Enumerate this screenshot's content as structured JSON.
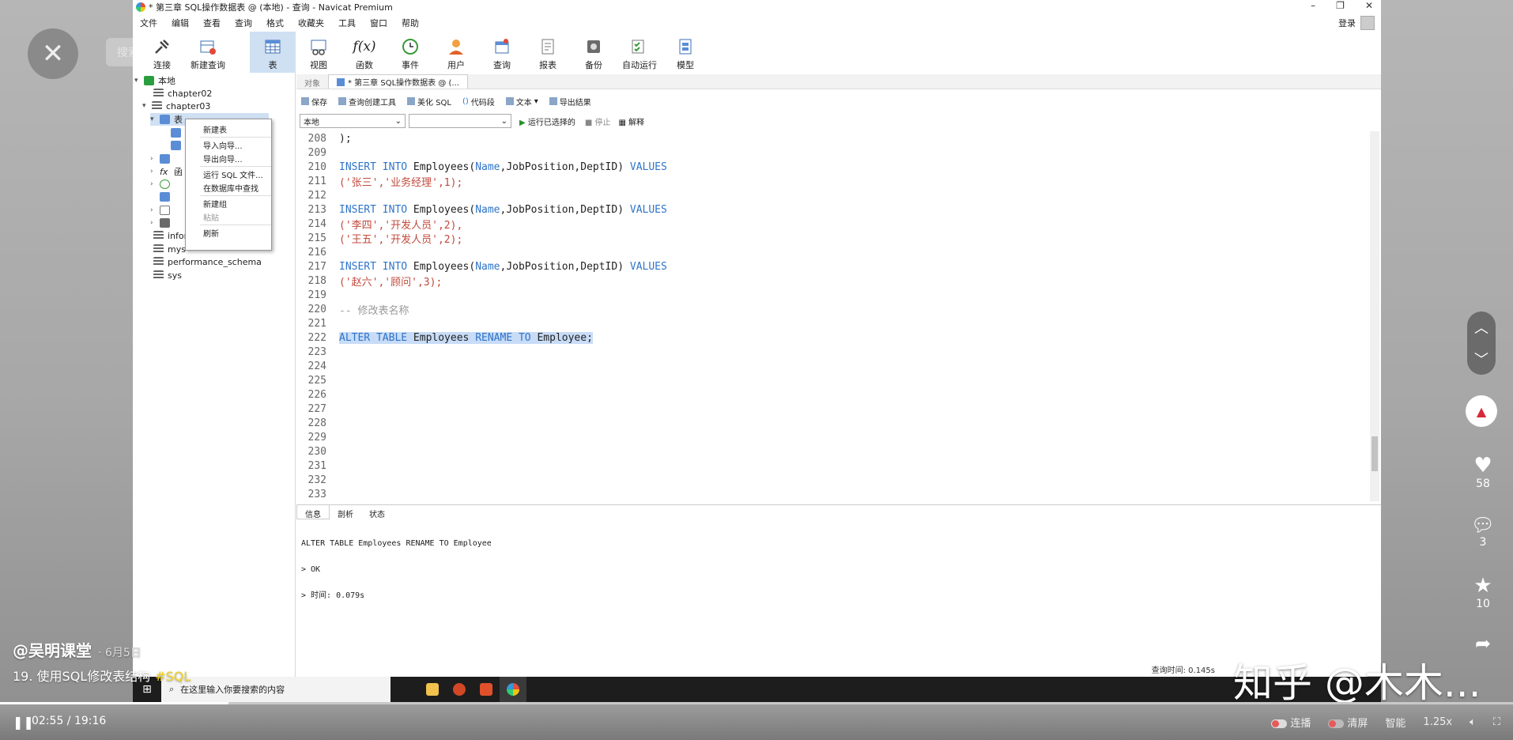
{
  "player": {
    "close_glyph": "✕",
    "search_placeholder": "搜索内容",
    "time_current": "02:55",
    "time_total": "19:16",
    "progress": 0.151,
    "danmaku_label": "连播",
    "clear_label": "清屏",
    "quality_label": "智能",
    "speed_label": "1.25x"
  },
  "video_info": {
    "author": "@吴明课堂",
    "date": "6月5日",
    "title": "19. 使用SQL修改表结构",
    "tag": "#SQL",
    "watermark": "知乎 @木木..."
  },
  "side_actions": {
    "likes": "58",
    "comments": "3",
    "stars": "10"
  },
  "window": {
    "title": "* 第三章 SQL操作数据表 @ (本地) - 查询 - Navicat Premium",
    "login_label": "登录",
    "menu": [
      "文件",
      "编辑",
      "查看",
      "查询",
      "格式",
      "收藏夹",
      "工具",
      "窗口",
      "帮助"
    ]
  },
  "toolbar": {
    "items": [
      {
        "label": "连接",
        "icon": "plug-icon"
      },
      {
        "label": "新建查询",
        "icon": "new-query-icon"
      },
      {
        "label": "表",
        "icon": "table-icon"
      },
      {
        "label": "视图",
        "icon": "view-icon"
      },
      {
        "label": "函数",
        "icon": "function-icon"
      },
      {
        "label": "事件",
        "icon": "clock-icon"
      },
      {
        "label": "用户",
        "icon": "user-icon"
      },
      {
        "label": "查询",
        "icon": "query-icon"
      },
      {
        "label": "报表",
        "icon": "report-icon"
      },
      {
        "label": "备份",
        "icon": "backup-icon"
      },
      {
        "label": "自动运行",
        "icon": "autorun-icon"
      },
      {
        "label": "模型",
        "icon": "model-icon"
      }
    ]
  },
  "tree": {
    "root": "本地",
    "db1": "chapter02",
    "db2": "chapter03",
    "tables": "表",
    "fn": "函",
    "db_info": "infor",
    "db_mysql": "mys",
    "db_perf": "performance_schema",
    "db_sys": "sys"
  },
  "context_menu": {
    "new_table": "新建表",
    "import": "导入向导...",
    "export": "导出向导...",
    "run_sql": "运行 SQL 文件...",
    "find": "在数据库中查找",
    "new_group": "新建组",
    "paste": "粘贴",
    "refresh": "刷新"
  },
  "tabs": {
    "objects": "对象",
    "query_tab": "* 第三章 SQL操作数据表 @ (..."
  },
  "query_toolbar": {
    "save": "保存",
    "builder": "查询创建工具",
    "beautify": "美化 SQL",
    "snippet": "代码段",
    "text": "文本",
    "export": "导出结果"
  },
  "connection_bar": {
    "conn": "本地",
    "db": "",
    "run_selected": "运行已选择的",
    "stop": "停止",
    "explain": "解释"
  },
  "editor": {
    "l208": "208",
    "l209": "209",
    "l210": "210",
    "l211": "211",
    "l212": "212",
    "l213": "213",
    "l214": "214",
    "l215": "215",
    "l216": "216",
    "l217": "217",
    "l218": "218",
    "l219": "219",
    "l220": "220",
    "l221": "221",
    "l222": "222",
    "l223": "223",
    "l224": "224",
    "l225": "225",
    "l226": "226",
    "l227": "227",
    "l228": "228",
    "l229": "229",
    "l230": "230",
    "l231": "231",
    "l232": "232",
    "l233": "233",
    "c208": ");",
    "insert": "INSERT INTO",
    "emp_cols_a": " Employees(",
    "col_name": "Name",
    "emp_cols_b": ",JobPosition,DeptID) ",
    "values": "VALUES",
    "r211": "('张三','业务经理',1);",
    "r214": "('李四','开发人员',2),",
    "r215": "('王五','开发人员',2);",
    "r218": "('赵六','顾问',3);",
    "c220": "-- 修改表名称",
    "alter": "ALTER TABLE",
    "alter_b": " Employees ",
    "rename": "RENAME TO",
    "alter_c": " Employee;"
  },
  "bottom_tabs": {
    "info": "信息",
    "profile": "剖析",
    "status": "状态"
  },
  "output": {
    "l1": "ALTER TABLE Employees RENAME TO Employee",
    "l2": "> OK",
    "l3": "> 时间: 0.079s"
  },
  "status": {
    "query_time": "查询时间: 0.145s"
  },
  "taskbar": {
    "search": "在这里输入你要搜索的内容"
  }
}
